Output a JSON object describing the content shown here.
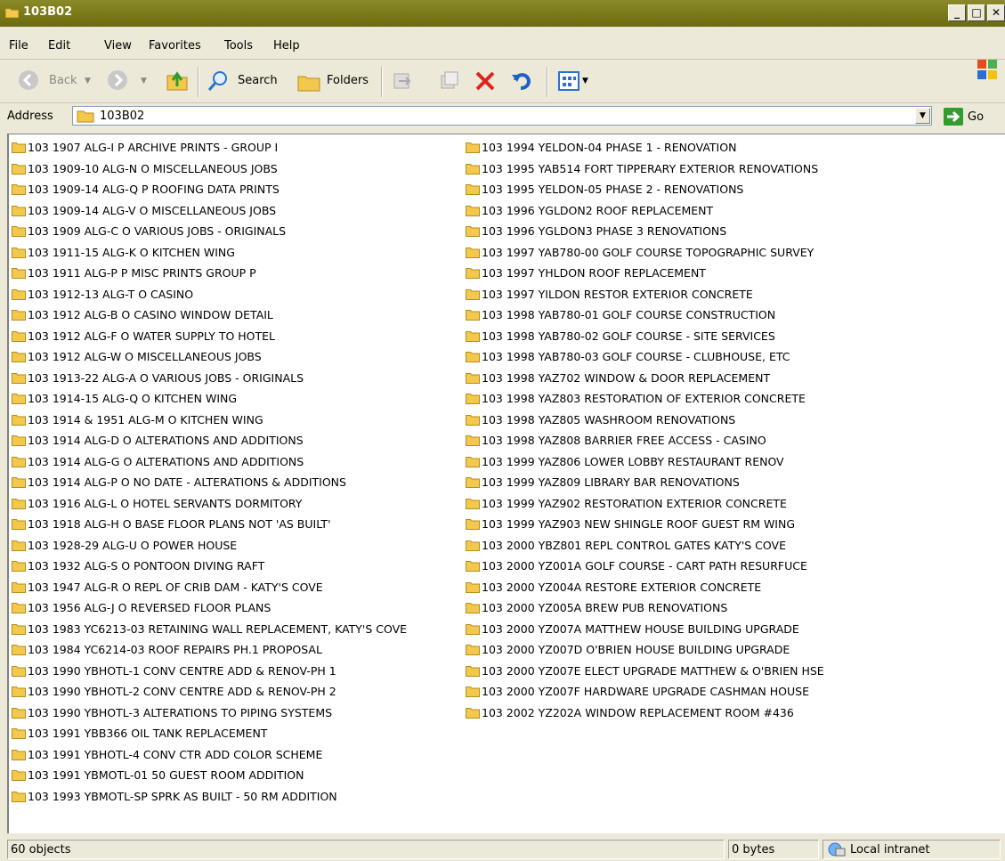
{
  "window": {
    "title": "103B02"
  },
  "menu": [
    "File",
    "Edit",
    "View",
    "Favorites",
    "Tools",
    "Help"
  ],
  "toolbar": {
    "back_label": "Back",
    "search_label": "Search",
    "folders_label": "Folders"
  },
  "address": {
    "label": "Address",
    "value": "103B02",
    "go_label": "Go"
  },
  "folders": [
    "103 1907 ALG-I P ARCHIVE PRINTS - GROUP I",
    "103 1909-10 ALG-N O MISCELLANEOUS JOBS",
    "103 1909-14 ALG-Q P ROOFING DATA PRINTS",
    "103 1909-14 ALG-V O MISCELLANEOUS JOBS",
    "103 1909 ALG-C O VARIOUS JOBS - ORIGINALS",
    "103 1911-15 ALG-K O KITCHEN WING",
    "103 1911 ALG-P P MISC PRINTS GROUP P",
    "103 1912-13 ALG-T O CASINO",
    "103 1912 ALG-B O CASINO WINDOW DETAIL",
    "103 1912 ALG-F O WATER SUPPLY TO HOTEL",
    "103 1912 ALG-W O MISCELLANEOUS JOBS",
    "103 1913-22 ALG-A O VARIOUS JOBS - ORIGINALS",
    "103 1914-15 ALG-Q O KITCHEN WING",
    "103 1914 & 1951 ALG-M O KITCHEN WING",
    "103 1914 ALG-D O ALTERATIONS AND ADDITIONS",
    "103 1914 ALG-G O ALTERATIONS AND ADDITIONS",
    "103 1914 ALG-P O NO DATE - ALTERATIONS & ADDITIONS",
    "103 1916 ALG-L O HOTEL SERVANTS DORMITORY",
    "103 1918 ALG-H O BASE FLOOR PLANS NOT 'AS BUILT'",
    "103 1928-29 ALG-U O POWER HOUSE",
    "103 1932 ALG-S O PONTOON DIVING RAFT",
    "103 1947 ALG-R O REPL OF CRIB DAM - KATY'S COVE",
    "103 1956 ALG-J O REVERSED FLOOR PLANS",
    "103 1983 YC6213-03 RETAINING WALL REPLACEMENT, KATY'S COVE",
    "103 1984 YC6214-03 ROOF REPAIRS PH.1 PROPOSAL",
    "103 1990 YBHOTL-1 CONV CENTRE ADD & RENOV-PH 1",
    "103 1990 YBHOTL-2 CONV CENTRE ADD & RENOV-PH 2",
    "103 1990 YBHOTL-3 ALTERATIONS TO PIPING SYSTEMS",
    "103 1991 YBB366 OIL TANK REPLACEMENT",
    "103 1991 YBHOTL-4 CONV CTR ADD COLOR SCHEME",
    "103 1991 YBMOTL-01 50 GUEST ROOM ADDITION",
    "103 1993 YBMOTL-SP SPRK AS BUILT - 50 RM ADDITION",
    "103 1994 YELDON-04 PHASE 1 - RENOVATION",
    "103 1995 YAB514 FORT TIPPERARY EXTERIOR RENOVATIONS",
    "103 1995 YELDON-05 PHASE 2 - RENOVATIONS",
    "103 1996 YGLDON2 ROOF REPLACEMENT",
    "103 1996 YGLDON3 PHASE 3 RENOVATIONS",
    "103 1997 YAB780-00 GOLF COURSE TOPOGRAPHIC SURVEY",
    "103 1997 YHLDON ROOF REPLACEMENT",
    "103 1997 YILDON RESTOR EXTERIOR CONCRETE",
    "103 1998 YAB780-01 GOLF COURSE CONSTRUCTION",
    "103 1998 YAB780-02 GOLF COURSE - SITE SERVICES",
    "103 1998 YAB780-03 GOLF COURSE - CLUBHOUSE, ETC",
    "103 1998 YAZ702 WINDOW & DOOR REPLACEMENT",
    "103 1998 YAZ803 RESTORATION OF EXTERIOR CONCRETE",
    "103 1998 YAZ805 WASHROOM RENOVATIONS",
    "103 1998 YAZ808 BARRIER FREE ACCESS - CASINO",
    "103 1999 YAZ806 LOWER LOBBY RESTAURANT RENOV",
    "103 1999 YAZ809 LIBRARY BAR RENOVATIONS",
    "103 1999 YAZ902 RESTORATION EXTERIOR CONCRETE",
    "103 1999 YAZ903 NEW SHINGLE ROOF GUEST RM WING",
    "103 2000 YBZ801 REPL CONTROL GATES KATY'S COVE",
    "103 2000 YZ001A GOLF COURSE - CART PATH RESURFUCE",
    "103 2000 YZ004A RESTORE EXTERIOR CONCRETE",
    "103 2000 YZ005A BREW PUB RENOVATIONS",
    "103 2000 YZ007A MATTHEW HOUSE BUILDING UPGRADE",
    "103 2000 YZ007D O'BRIEN HOUSE BUILDING UPGRADE",
    "103 2000 YZ007E ELECT UPGRADE MATTHEW & O'BRIEN HSE",
    "103 2000 YZ007F HARDWARE UPGRADE CASHMAN HOUSE",
    "103 2002 YZ202A WINDOW REPLACEMENT ROOM #436"
  ],
  "status": {
    "objects": "60 objects",
    "size": "0 bytes",
    "zone": "Local intranet"
  },
  "colors": {
    "titlebar": "#7a7a18",
    "folder": "#f2c94c"
  }
}
